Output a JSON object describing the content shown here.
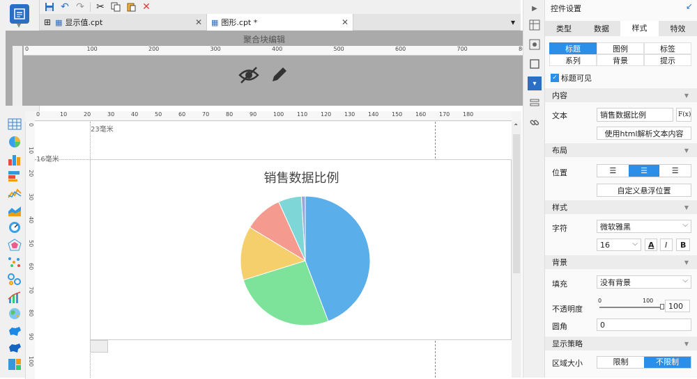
{
  "tabs": [
    {
      "label": "显示值.cpt",
      "close": "✕"
    },
    {
      "label": "图形.cpt *",
      "close": "✕"
    }
  ],
  "aggregate_title": "聚合块编辑",
  "top_ruler": [
    "0",
    "100",
    "200",
    "300",
    "400",
    "500",
    "600",
    "700",
    "80"
  ],
  "canvas_ruler": [
    "0",
    "10",
    "20",
    "30",
    "40",
    "50",
    "60",
    "70",
    "80",
    "90",
    "100",
    "110",
    "120",
    "130",
    "140",
    "150",
    "160",
    "170",
    "180"
  ],
  "canvas_vruler": [
    "0",
    "10",
    "20",
    "30",
    "40",
    "50",
    "60",
    "70",
    "80",
    "90",
    "100"
  ],
  "guides": {
    "top": "23毫米",
    "left": "16毫米"
  },
  "chart": {
    "title": "销售数据比例"
  },
  "chart_data": {
    "type": "pie",
    "title": "销售数据比例",
    "values": [
      46,
      27,
      14,
      10,
      6,
      1
    ],
    "colors": [
      "#5aaeea",
      "#7ee39a",
      "#f6cf6d",
      "#f49a8f",
      "#7ed7d6",
      "#9aa8d8"
    ]
  },
  "panel": {
    "header": "控件设置",
    "pin": "↙",
    "main_tabs": [
      "类型",
      "数据",
      "样式",
      "特效"
    ],
    "sub_tabs": [
      [
        "标题",
        "图例",
        "标签"
      ],
      [
        "系列",
        "背景",
        "提示"
      ]
    ],
    "title_visible": "标题可见",
    "sec_content": "内容",
    "text_label": "文本",
    "text_value": "销售数据比例",
    "fx": "F(x)",
    "html_btn": "使用html解析文本内容",
    "sec_layout": "布局",
    "position_label": "位置",
    "float_btn": "自定义悬浮位置",
    "sec_style": "样式",
    "font_label": "字符",
    "font_value": "微软雅黑",
    "font_size": "16",
    "bold": "B",
    "italic": "I",
    "color": "A",
    "sec_bg": "背景",
    "fill_label": "填充",
    "fill_value": "没有背景",
    "opacity_label": "不透明度",
    "opacity_min": "0",
    "opacity_max": "100",
    "opacity_value": "100",
    "radius_label": "圆角",
    "radius_value": "0",
    "sec_strategy": "显示策略",
    "area_label": "区域大小",
    "limit": "限制",
    "nolimit": "不限制"
  }
}
